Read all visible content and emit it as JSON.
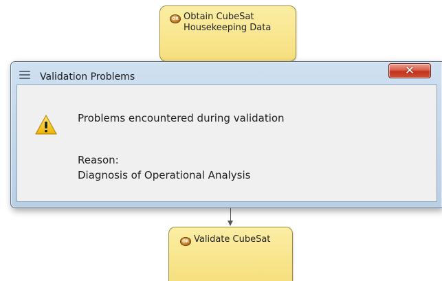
{
  "diagram": {
    "nodes": [
      {
        "badge": "OR",
        "label": "Obtain CubeSat\nHousekeeping Data"
      },
      {
        "badge": "OR",
        "label": "Validate CubeSat"
      }
    ]
  },
  "dialog": {
    "title": "Validation Problems",
    "close_glyph": "✕",
    "message": "Problems encountered during validation",
    "reason_label": "Reason:",
    "reason_text": "Diagnosis of Operational Analysis",
    "icons": {
      "title": "menu-lines-icon",
      "warning": "warning-icon",
      "close": "close-icon"
    }
  },
  "colors": {
    "node_fill": "#f6df7e",
    "close_button": "#c2321c",
    "dialog_frame": "#b9cfe6",
    "warning_fill": "#f7c928"
  }
}
